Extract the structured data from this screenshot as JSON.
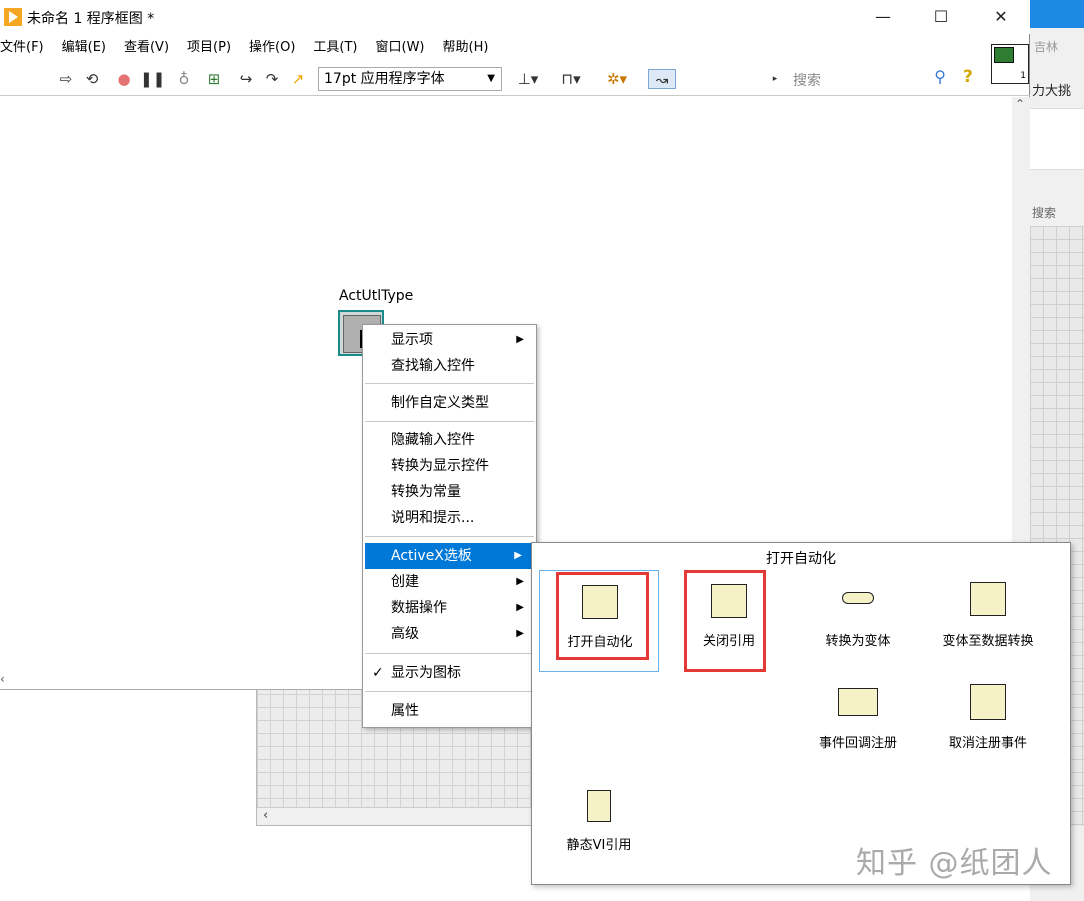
{
  "window": {
    "title": "未命名 1 程序框图 *",
    "minimize": "—",
    "maximize": "☐",
    "close": "✕"
  },
  "menubar": [
    "文件(F)",
    "编辑(E)",
    "查看(V)",
    "项目(P)",
    "操作(O)",
    "工具(T)",
    "窗口(W)",
    "帮助(H)"
  ],
  "toolbar": {
    "font": "17pt 应用程序字体",
    "search_placeholder": "搜索"
  },
  "background_window": {
    "text1": "吉林",
    "text2": "力大挑",
    "text3": "搜索"
  },
  "node": {
    "label": "ActUtlType"
  },
  "context_menu": {
    "group1": [
      "显示项",
      "查找输入控件"
    ],
    "group2": [
      "制作自定义类型"
    ],
    "group3": [
      "隐藏输入控件",
      "转换为显示控件",
      "转换为常量",
      "说明和提示..."
    ],
    "group4": [
      "ActiveX选板",
      "创建",
      "数据操作",
      "高级"
    ],
    "group5": [
      "显示为图标"
    ],
    "group6": [
      "属性"
    ]
  },
  "palette": {
    "title": "打开自动化",
    "items": [
      "打开自动化",
      "关闭引用",
      "转换为变体",
      "变体至数据转换",
      "事件回调注册",
      "取消注册事件",
      "静态VI引用"
    ]
  },
  "watermark": "知乎 @纸团人",
  "colors": {
    "highlight": "#0078d7",
    "annotation_red": "#e53935"
  }
}
